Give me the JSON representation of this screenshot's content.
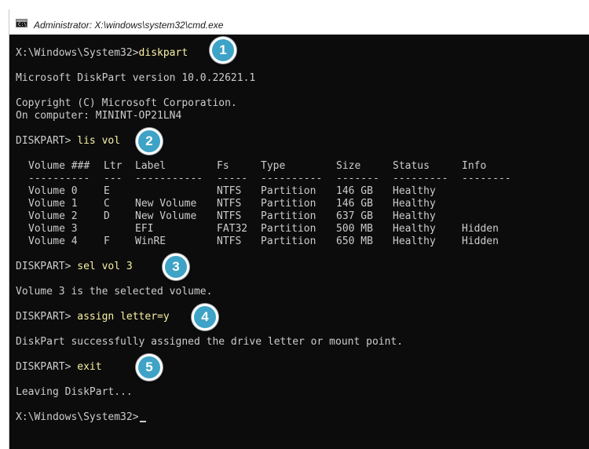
{
  "window": {
    "title": "Administrator: X:\\windows\\system32\\cmd.exe",
    "icon": "cmd-app-icon",
    "icon_glyph": "C:\\"
  },
  "console": {
    "prompt1": {
      "prompt": "X:\\Windows\\System32>",
      "command": "diskpart"
    },
    "version": "Microsoft DiskPart version 10.0.22621.1",
    "copyright": "Copyright (C) Microsoft Corporation.",
    "computer": "On computer: MININT-OP21LN4",
    "prompt2": {
      "prompt": "DISKPART> ",
      "command": "lis vol"
    },
    "table": {
      "headers": [
        "Volume ###",
        "Ltr",
        "Label",
        "Fs",
        "Type",
        "Size",
        "Status",
        "Info"
      ],
      "separators": [
        "----------",
        "---",
        "-----------",
        "-----",
        "----------",
        "-------",
        "---------",
        "--------"
      ],
      "rows": [
        [
          "Volume 0",
          "E",
          "",
          "NTFS",
          "Partition",
          "146 GB",
          "Healthy",
          ""
        ],
        [
          "Volume 1",
          "C",
          "New Volume",
          "NTFS",
          "Partition",
          "146 GB",
          "Healthy",
          ""
        ],
        [
          "Volume 2",
          "D",
          "New Volume",
          "NTFS",
          "Partition",
          "637 GB",
          "Healthy",
          ""
        ],
        [
          "Volume 3",
          "",
          "EFI",
          "FAT32",
          "Partition",
          "500 MB",
          "Healthy",
          "Hidden"
        ],
        [
          "Volume 4",
          "F",
          "WinRE",
          "NTFS",
          "Partition",
          "650 MB",
          "Healthy",
          "Hidden"
        ]
      ],
      "highlight_row": 3
    },
    "prompt3": {
      "prompt": "DISKPART> ",
      "command": "sel vol 3"
    },
    "selected": "Volume 3 is the selected volume.",
    "prompt4": {
      "prompt": "DISKPART> ",
      "command": "assign letter=y"
    },
    "assigned": "DiskPart successfully assigned the drive letter or mount point.",
    "prompt5": {
      "prompt": "DISKPART> ",
      "command": "exit"
    },
    "leaving": "Leaving DiskPart...",
    "prompt6": {
      "prompt": "X:\\Windows\\System32>"
    }
  },
  "badges": [
    "1",
    "2",
    "3",
    "4",
    "5"
  ],
  "colors": {
    "background": "#0c0c0c",
    "text": "#cccccc",
    "command": "#f9f1a5",
    "highlight_row": "#c19c00",
    "badge": "#3ea3c6"
  }
}
